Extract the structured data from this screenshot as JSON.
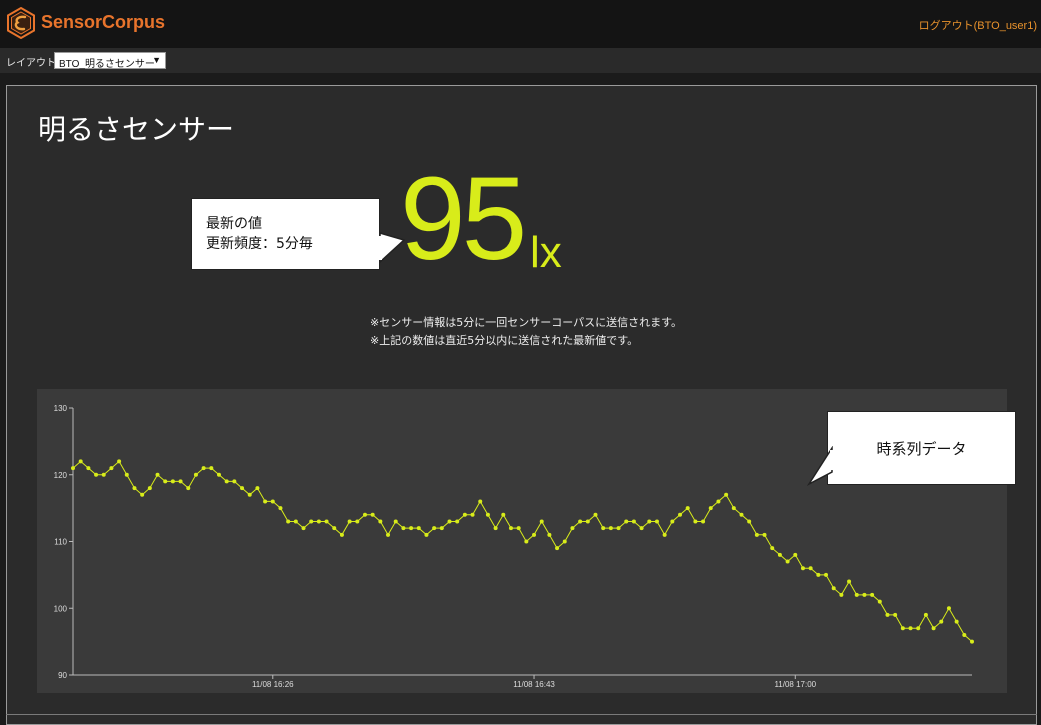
{
  "app": {
    "name": "SensorCorpus",
    "logout_label": "ログアウト(BTO_user1)",
    "accent_color": "#e8742c"
  },
  "layout": {
    "label": "レイアウト",
    "selected": "BTO_明るさセンサー"
  },
  "panel": {
    "title": "明るさセンサー",
    "value": "95",
    "unit": "lx",
    "note1": "※センサー情報は5分に一回センサーコーパスに送信されます。",
    "note2": "※上記の数値は直近5分以内に送信された最新値です。",
    "callout_latest_line1": "最新の値",
    "callout_latest_line2": "更新頻度：5分毎",
    "callout_timeseries": "時系列データ"
  },
  "chart_data": {
    "type": "line",
    "title": "",
    "xlabel": "",
    "ylabel": "",
    "ylim": [
      90,
      130
    ],
    "yticks": [
      90,
      100,
      110,
      120,
      130
    ],
    "xticks": [
      {
        "label": "11/08 16:26",
        "index": 26
      },
      {
        "label": "11/08 16:43",
        "index": 60
      },
      {
        "label": "11/08 17:00",
        "index": 94
      }
    ],
    "series_color": "#d8ec1a",
    "values": [
      121,
      122,
      121,
      120,
      120,
      121,
      122,
      120,
      118,
      117,
      118,
      120,
      119,
      119,
      119,
      118,
      120,
      121,
      121,
      120,
      119,
      119,
      118,
      117,
      118,
      116,
      116,
      115,
      113,
      113,
      112,
      113,
      113,
      113,
      112,
      111,
      113,
      113,
      114,
      114,
      113,
      111,
      113,
      112,
      112,
      112,
      111,
      112,
      112,
      113,
      113,
      114,
      114,
      116,
      114,
      112,
      114,
      112,
      112,
      110,
      111,
      113,
      111,
      109,
      110,
      112,
      113,
      113,
      114,
      112,
      112,
      112,
      113,
      113,
      112,
      113,
      113,
      111,
      113,
      114,
      115,
      113,
      113,
      115,
      116,
      117,
      115,
      114,
      113,
      111,
      111,
      109,
      108,
      107,
      108,
      106,
      106,
      105,
      105,
      103,
      102,
      104,
      102,
      102,
      102,
      101,
      99,
      99,
      97,
      97,
      97,
      99,
      97,
      98,
      100,
      98,
      96,
      95
    ]
  }
}
